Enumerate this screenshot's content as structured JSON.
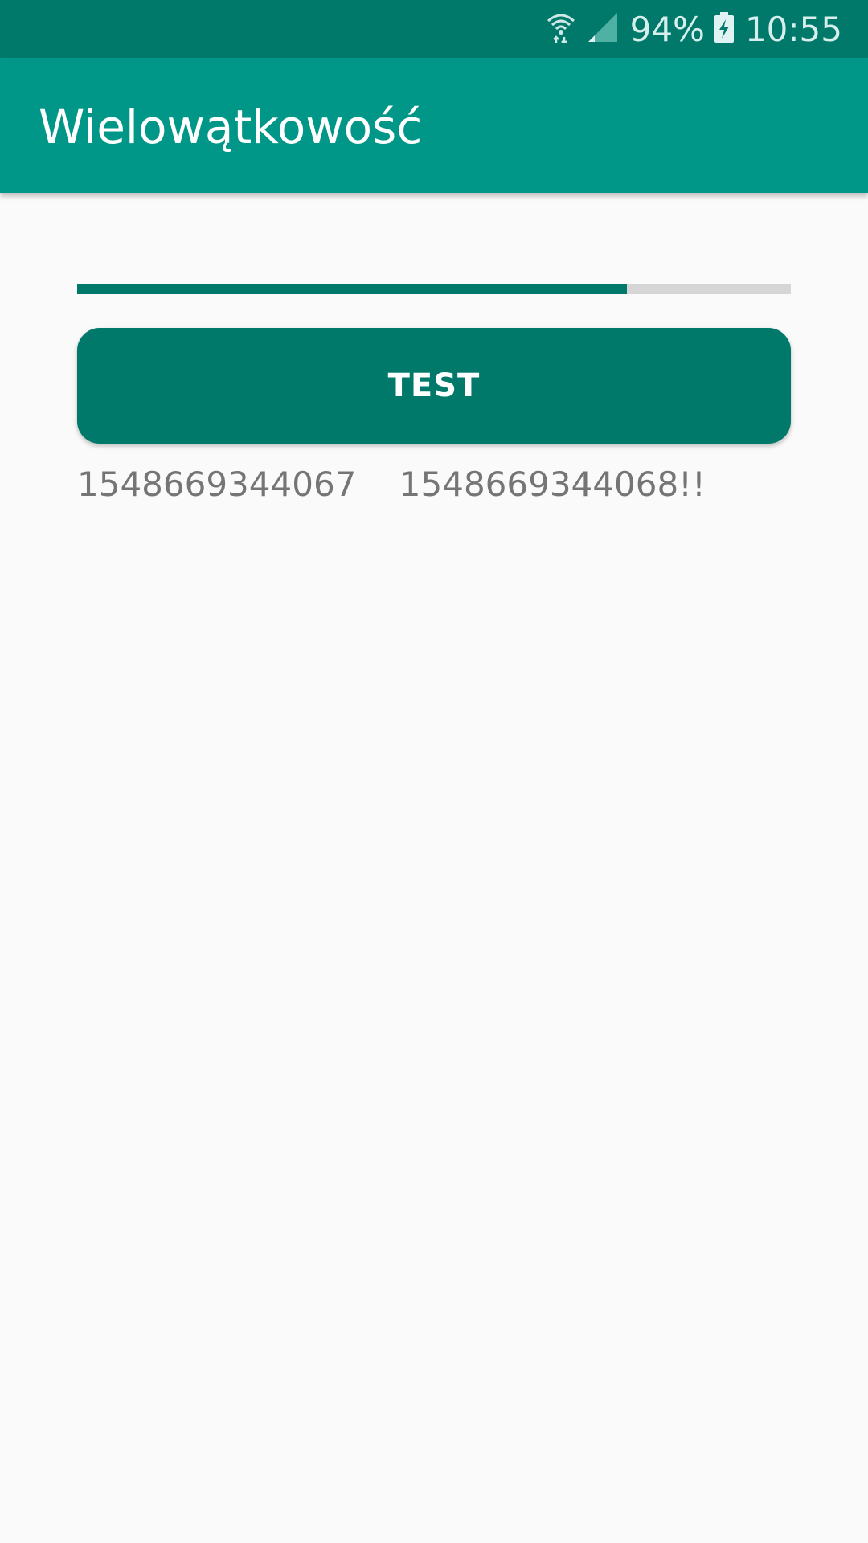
{
  "status_bar": {
    "wifi_icon": "wifi-icon",
    "signal_icon": "cell-signal-icon",
    "battery_percent": "94%",
    "battery_icon": "battery-charging-icon",
    "time": "10:55"
  },
  "app_bar": {
    "title": "Wielowątkowość"
  },
  "progress": {
    "fraction": 0.77
  },
  "button": {
    "label": "TEST"
  },
  "output": {
    "text": "1548669344067    1548669344068!!"
  },
  "colors": {
    "status_bar": "#00796b",
    "app_bar": "#009688",
    "accent": "#00796b",
    "background": "#fafafa"
  }
}
